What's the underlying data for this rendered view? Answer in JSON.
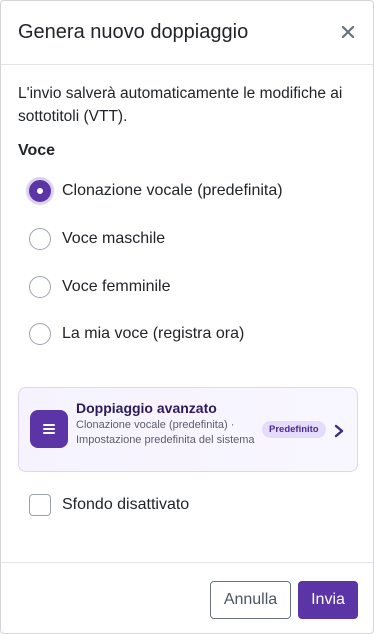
{
  "modal": {
    "title": "Genera nuovo doppiaggio",
    "close_icon": "close-icon"
  },
  "info_text": "L'invio salverà automaticamente le modifiche ai sottotitoli (VTT).",
  "voice": {
    "label": "Voce",
    "selected": "Clonazione vocale (predefinita)",
    "options": [
      {
        "label": "Clonazione vocale (predefinita)",
        "checked": true
      },
      {
        "label": "Voce maschile",
        "checked": false
      },
      {
        "label": "Voce femminile",
        "checked": false
      },
      {
        "label": "La mia voce (registra ora)",
        "checked": false
      }
    ]
  },
  "advanced": {
    "title": "Doppiaggio avanzato",
    "description": "Clonazione vocale (predefinita) · Impostazione predefinita del sistema",
    "badge": "Predefinito",
    "icon": "list-icon",
    "chevron": "chevron-right-icon"
  },
  "background": {
    "label": "Sfondo disattivato",
    "checked": false
  },
  "footer": {
    "cancel_label": "Annulla",
    "submit_label": "Invia"
  },
  "colors": {
    "accent": "#5b34a6",
    "badge_bg": "#e5dcfb",
    "card_bg": "#f6f3fe"
  }
}
